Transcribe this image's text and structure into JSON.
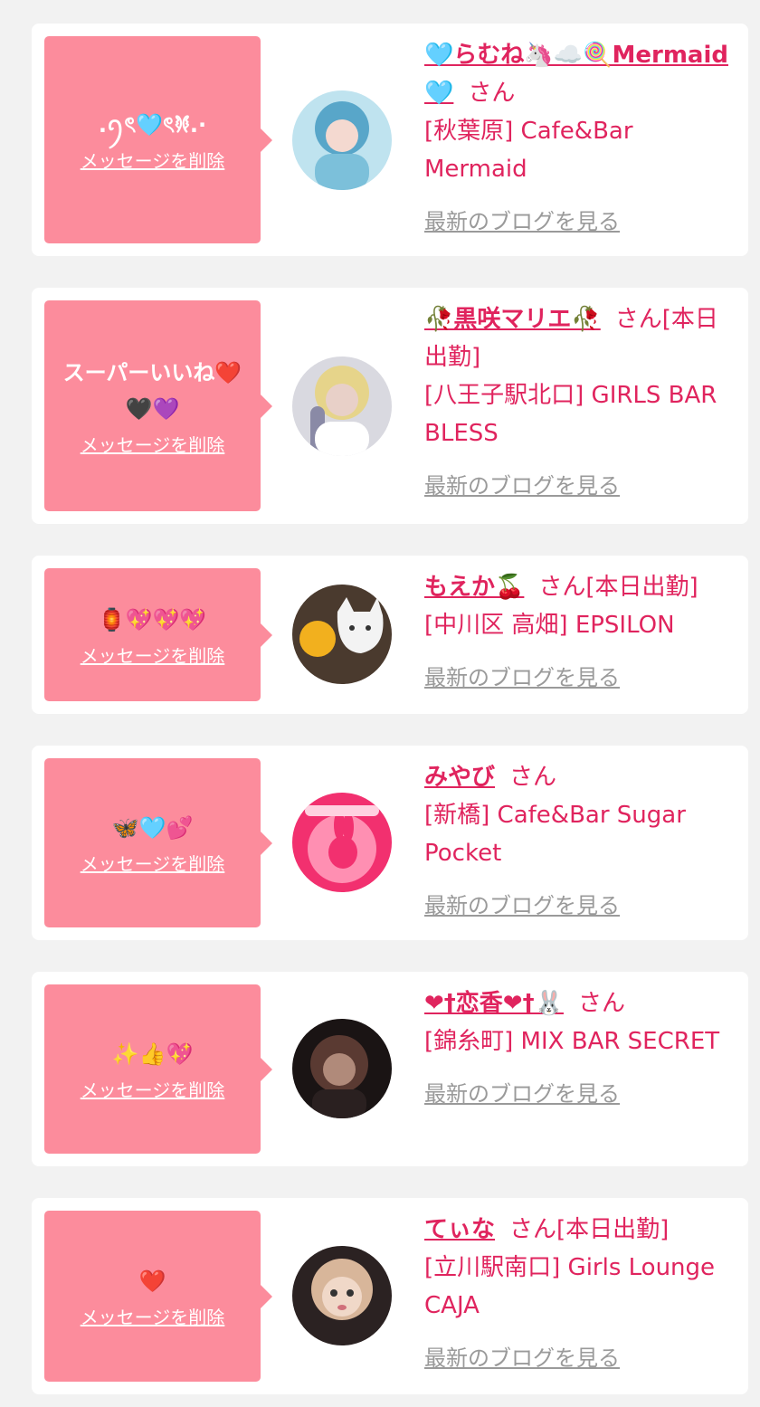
{
  "delete_label": "メッセージを削除",
  "blog_label": "最新のブログを見る",
  "colors": {
    "bubble": "#fc8c9c",
    "accent": "#e0245e",
    "muted_link": "#9a9a9a",
    "page_bg": "#f2f2f2"
  },
  "cards": [
    {
      "message": ".ꪆৎ🩵ৎ𐦍.·",
      "name": "🩵らむね🦄☁️🍭Mermaid🩵",
      "suffix": "さん",
      "shop": "[秋葉原] Cafe&Bar Mermaid",
      "avatar_icon": "avatar-photo-icon",
      "avatar_colors": [
        "#bfe3ef",
        "#58a6c9",
        "#f4d9d0"
      ]
    },
    {
      "message": "スーパーいいね❤️🖤💜",
      "name": "🥀黒咲マリエ🥀",
      "suffix": "さん[本日出勤]",
      "shop": "[八王子駅北口] GIRLS BAR BLESS",
      "avatar_icon": "avatar-photo-icon",
      "avatar_colors": [
        "#d9d9e0",
        "#8a8aa6",
        "#e8d0c8"
      ]
    },
    {
      "message": "🏮💖💖💖",
      "name": "もえか🍒",
      "suffix": "さん[本日出勤]",
      "shop": "[中川区 高畑] EPSILON",
      "avatar_icon": "avatar-photo-icon",
      "avatar_colors": [
        "#4a3a2e",
        "#f2b01e",
        "#f3f3f3"
      ]
    },
    {
      "message": "🦋🩵💕",
      "name": "みやび",
      "suffix": "さん",
      "shop": "[新橋] Cafe&Bar Sugar Pocket",
      "avatar_icon": "avatar-rabbit-icon",
      "avatar_colors": [
        "#f2306f",
        "#ff8fb2",
        "#ffd1e0"
      ]
    },
    {
      "message": "✨👍💖",
      "name": "❤†恋香❤†🐰",
      "suffix": "さん",
      "shop": "[錦糸町] MIX BAR SECRET",
      "avatar_icon": "avatar-photo-icon",
      "avatar_colors": [
        "#1a1414",
        "#5a3a32",
        "#b08a7a"
      ]
    },
    {
      "message": "❤️",
      "name": "てぃな",
      "suffix": "さん[本日出勤]",
      "shop": "[立川駅南口] Girls Lounge CAJA",
      "avatar_icon": "avatar-photo-icon",
      "avatar_colors": [
        "#2b2222",
        "#d8b69a",
        "#f0d8c8"
      ]
    }
  ]
}
